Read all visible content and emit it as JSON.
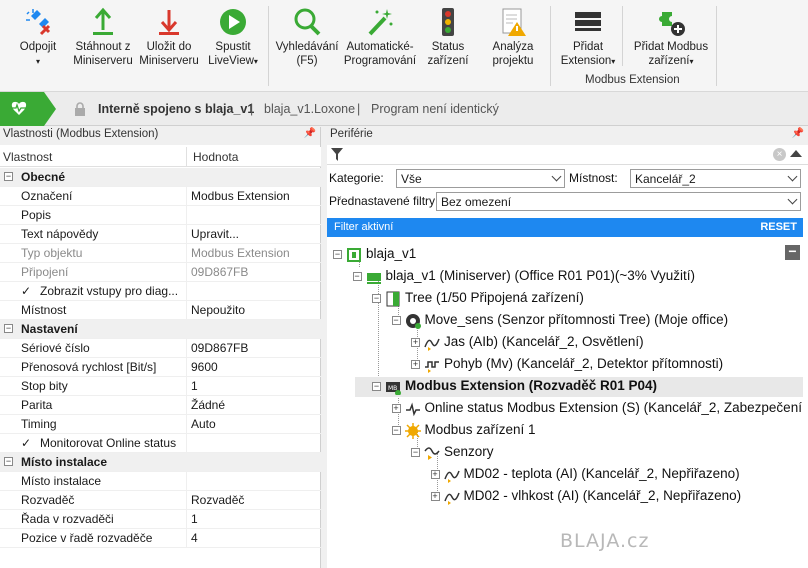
{
  "ribbon": {
    "buttons": [
      {
        "id": "odpojit",
        "label": "Odpojit",
        "caret": "▾",
        "icon": "disconnect-icon"
      },
      {
        "id": "stahnout",
        "label": "Stáhnout z Miniserveru",
        "icon": "download-icon"
      },
      {
        "id": "ulozit",
        "label": "Uložit do Miniserveru",
        "icon": "upload-icon"
      },
      {
        "id": "liveview",
        "label": "Spustit LiveView",
        "caret": "▾",
        "icon": "play-icon"
      },
      {
        "id": "vyhledavani",
        "label": "Vyhledávání (F5)",
        "icon": "search-icon"
      },
      {
        "id": "autoprog",
        "label": "Automatické- Programování",
        "icon": "magic-wand-icon"
      },
      {
        "id": "status",
        "label": "Status zařízení",
        "icon": "traffic-light-icon"
      },
      {
        "id": "analyza",
        "label": "Analýza projektu",
        "icon": "analysis-icon"
      },
      {
        "id": "pridat-ext",
        "label": "Přidat Extension",
        "caret": "▾",
        "icon": "extension-icon"
      },
      {
        "id": "pridat-modbus",
        "label": "Přidat Modbus zařízení",
        "caret": "▾",
        "icon": "add-device-icon"
      }
    ],
    "group_modbus": "Modbus Extension"
  },
  "status": {
    "connected": "Interně spojeno s blaja_v1",
    "file": "blaja_v1.Loxone",
    "program": "Program není identický",
    "sep": "|"
  },
  "properties": {
    "title": "Vlastnosti (Modbus Extension)",
    "pin": "📌",
    "col_property": "Vlastnost",
    "col_value": "Hodnota",
    "rows": [
      {
        "type": "cat",
        "label": "Obecné",
        "toggle": "−"
      },
      {
        "label": "Označení",
        "value": "Modbus Extension"
      },
      {
        "label": "Popis",
        "value": ""
      },
      {
        "label": "Text nápovědy",
        "value": "Upravit..."
      },
      {
        "label": "Typ objektu",
        "value": "Modbus Extension",
        "grey": true
      },
      {
        "label": "Připojení",
        "value": "09D867FB",
        "grey": true
      },
      {
        "label": "Zobrazit vstupy pro diag...",
        "value": "",
        "check": "✓"
      },
      {
        "label": "Místnost",
        "value": "Nepoužito"
      },
      {
        "type": "cat",
        "label": "Nastavení",
        "toggle": "−"
      },
      {
        "label": "Sériové číslo",
        "value": "09D867FB"
      },
      {
        "label": "Přenosová rychlost [Bit/s]",
        "value": "9600"
      },
      {
        "label": "Stop bity",
        "value": "1"
      },
      {
        "label": "Parita",
        "value": "Žádné"
      },
      {
        "label": "Timing",
        "value": "Auto"
      },
      {
        "label": "Monitorovat Online status",
        "value": "",
        "check": "✓"
      },
      {
        "type": "cat",
        "label": "Místo instalace",
        "toggle": "−"
      },
      {
        "label": "Místo instalace",
        "value": ""
      },
      {
        "label": "Rozvaděč",
        "value": "Rozvaděč"
      },
      {
        "label": "Řada v rozvaděči",
        "value": "1"
      },
      {
        "label": "Pozice v řadě rozvaděče",
        "value": "4"
      }
    ]
  },
  "periferie": {
    "title": "Periférie",
    "pin": "📌",
    "clear": "×",
    "kategorie_label": "Kategorie:",
    "kategorie_value": "Vše",
    "mistnost_label": "Místnost:",
    "mistnost_value": "Kancelář_2",
    "preset_label": "Přednastavené filtry",
    "preset_value": "Bez omezení",
    "filter_active": "Filter aktivní",
    "reset": "RESET",
    "collapse": "−",
    "watermark": "BLAJA.cz",
    "tree": [
      {
        "id": "n0",
        "label": "blaja_v1",
        "icon": "project-icon",
        "toggle": "−"
      },
      {
        "id": "n1",
        "label": "blaja_v1 (Miniserver) (Office R01 P01)(~3% Využití)",
        "icon": "miniserver-icon",
        "toggle": "−"
      },
      {
        "id": "n2",
        "label": "Tree  (1/50 Připojená zařízení)",
        "icon": "tree-extension-icon",
        "toggle": "−"
      },
      {
        "id": "n3",
        "label": "Move_sens (Senzor přítomnosti Tree) (Moje office)",
        "icon": "motion-sensor-icon",
        "toggle": "−"
      },
      {
        "id": "n4",
        "label": "Jas (AIb) (Kancelář_2, Osvětlení)",
        "icon": "analog-input-icon",
        "toggle": "+"
      },
      {
        "id": "n5",
        "label": "Pohyb (Mv) (Kancelář_2, Detektor přítomnosti)",
        "icon": "digital-input-icon",
        "toggle": "+"
      },
      {
        "id": "n6",
        "label": "Modbus Extension (Rozvaděč R01 P04)",
        "icon": "modbus-extension-icon",
        "toggle": "−",
        "bold": true
      },
      {
        "id": "n7",
        "label": "Online status Modbus Extension (S) (Kancelář_2, Zabezpečení",
        "icon": "status-input-icon",
        "toggle": "+"
      },
      {
        "id": "n8",
        "label": "Modbus zařízení 1",
        "icon": "modbus-device-icon",
        "toggle": "−"
      },
      {
        "id": "n9",
        "label": "Senzory",
        "icon": "sensors-folder-icon",
        "toggle": "−"
      },
      {
        "id": "n10",
        "label": "MD02 - teplota (AI) (Kancelář_2, Nepřiřazeno)",
        "icon": "analog-input-icon",
        "toggle": "+"
      },
      {
        "id": "n11",
        "label": "MD02 - vlhkost (AI) (Kancelář_2, Nepřiřazeno)",
        "icon": "analog-input-icon",
        "toggle": "+"
      }
    ]
  },
  "colors": {
    "accent": "#1e88f0",
    "green": "#3aaa35",
    "red": "#d9382c"
  }
}
